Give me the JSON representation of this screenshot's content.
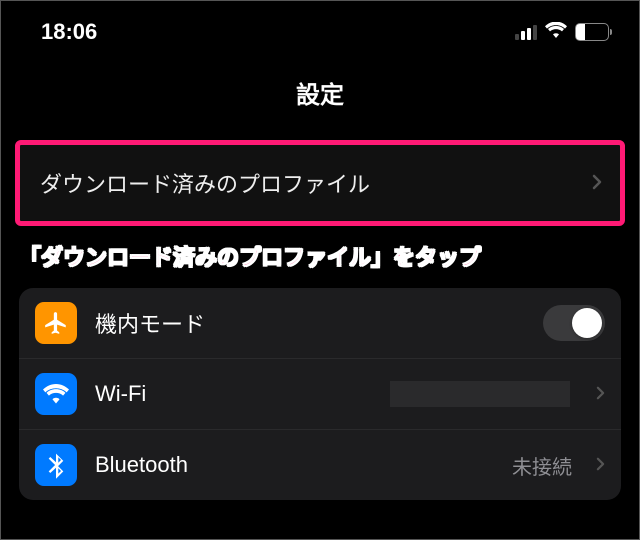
{
  "status": {
    "time": "18:06",
    "battery_percent": "28"
  },
  "header": {
    "title": "設定"
  },
  "profile_row": {
    "label": "ダウンロード済みのプロファイル"
  },
  "annotation": {
    "text": "「ダウンロード済みのプロファイル」をタップ"
  },
  "rows": {
    "airplane": {
      "label": "機内モード"
    },
    "wifi": {
      "label": "Wi-Fi"
    },
    "bluetooth": {
      "label": "Bluetooth",
      "value": "未接続"
    }
  },
  "colors": {
    "highlight": "#ff1a75",
    "airplane_icon_bg": "#ff9500",
    "wifi_icon_bg": "#007aff",
    "bluetooth_icon_bg": "#007aff"
  }
}
